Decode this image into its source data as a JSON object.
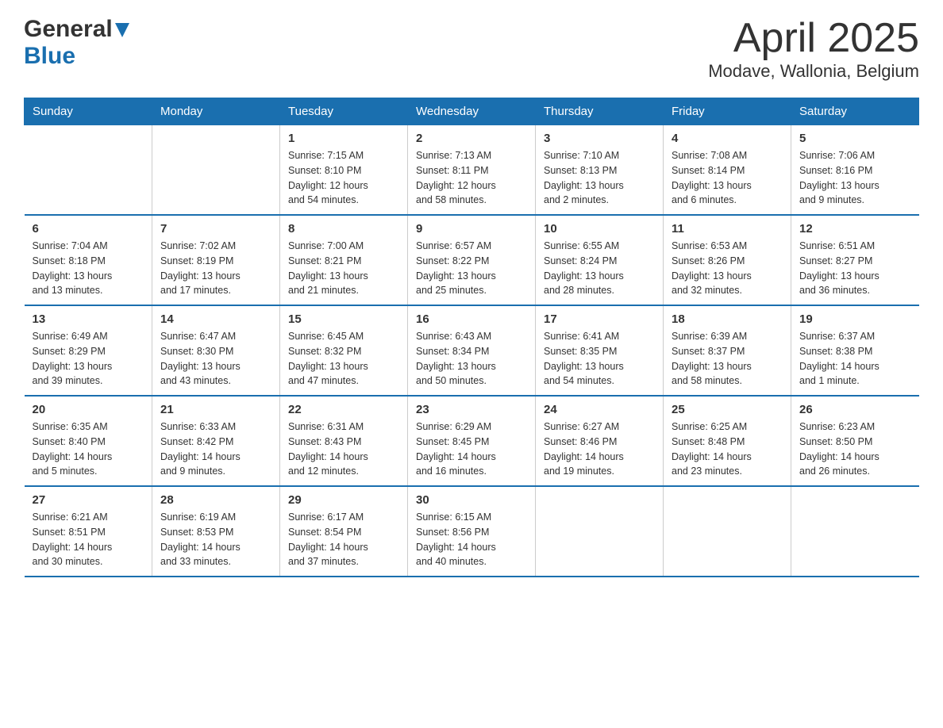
{
  "logo": {
    "general": "General",
    "blue": "Blue",
    "triangle": "▼"
  },
  "title": "April 2025",
  "subtitle": "Modave, Wallonia, Belgium",
  "days_header": [
    "Sunday",
    "Monday",
    "Tuesday",
    "Wednesday",
    "Thursday",
    "Friday",
    "Saturday"
  ],
  "weeks": [
    [
      {
        "day": "",
        "info": ""
      },
      {
        "day": "",
        "info": ""
      },
      {
        "day": "1",
        "info": "Sunrise: 7:15 AM\nSunset: 8:10 PM\nDaylight: 12 hours\nand 54 minutes."
      },
      {
        "day": "2",
        "info": "Sunrise: 7:13 AM\nSunset: 8:11 PM\nDaylight: 12 hours\nand 58 minutes."
      },
      {
        "day": "3",
        "info": "Sunrise: 7:10 AM\nSunset: 8:13 PM\nDaylight: 13 hours\nand 2 minutes."
      },
      {
        "day": "4",
        "info": "Sunrise: 7:08 AM\nSunset: 8:14 PM\nDaylight: 13 hours\nand 6 minutes."
      },
      {
        "day": "5",
        "info": "Sunrise: 7:06 AM\nSunset: 8:16 PM\nDaylight: 13 hours\nand 9 minutes."
      }
    ],
    [
      {
        "day": "6",
        "info": "Sunrise: 7:04 AM\nSunset: 8:18 PM\nDaylight: 13 hours\nand 13 minutes."
      },
      {
        "day": "7",
        "info": "Sunrise: 7:02 AM\nSunset: 8:19 PM\nDaylight: 13 hours\nand 17 minutes."
      },
      {
        "day": "8",
        "info": "Sunrise: 7:00 AM\nSunset: 8:21 PM\nDaylight: 13 hours\nand 21 minutes."
      },
      {
        "day": "9",
        "info": "Sunrise: 6:57 AM\nSunset: 8:22 PM\nDaylight: 13 hours\nand 25 minutes."
      },
      {
        "day": "10",
        "info": "Sunrise: 6:55 AM\nSunset: 8:24 PM\nDaylight: 13 hours\nand 28 minutes."
      },
      {
        "day": "11",
        "info": "Sunrise: 6:53 AM\nSunset: 8:26 PM\nDaylight: 13 hours\nand 32 minutes."
      },
      {
        "day": "12",
        "info": "Sunrise: 6:51 AM\nSunset: 8:27 PM\nDaylight: 13 hours\nand 36 minutes."
      }
    ],
    [
      {
        "day": "13",
        "info": "Sunrise: 6:49 AM\nSunset: 8:29 PM\nDaylight: 13 hours\nand 39 minutes."
      },
      {
        "day": "14",
        "info": "Sunrise: 6:47 AM\nSunset: 8:30 PM\nDaylight: 13 hours\nand 43 minutes."
      },
      {
        "day": "15",
        "info": "Sunrise: 6:45 AM\nSunset: 8:32 PM\nDaylight: 13 hours\nand 47 minutes."
      },
      {
        "day": "16",
        "info": "Sunrise: 6:43 AM\nSunset: 8:34 PM\nDaylight: 13 hours\nand 50 minutes."
      },
      {
        "day": "17",
        "info": "Sunrise: 6:41 AM\nSunset: 8:35 PM\nDaylight: 13 hours\nand 54 minutes."
      },
      {
        "day": "18",
        "info": "Sunrise: 6:39 AM\nSunset: 8:37 PM\nDaylight: 13 hours\nand 58 minutes."
      },
      {
        "day": "19",
        "info": "Sunrise: 6:37 AM\nSunset: 8:38 PM\nDaylight: 14 hours\nand 1 minute."
      }
    ],
    [
      {
        "day": "20",
        "info": "Sunrise: 6:35 AM\nSunset: 8:40 PM\nDaylight: 14 hours\nand 5 minutes."
      },
      {
        "day": "21",
        "info": "Sunrise: 6:33 AM\nSunset: 8:42 PM\nDaylight: 14 hours\nand 9 minutes."
      },
      {
        "day": "22",
        "info": "Sunrise: 6:31 AM\nSunset: 8:43 PM\nDaylight: 14 hours\nand 12 minutes."
      },
      {
        "day": "23",
        "info": "Sunrise: 6:29 AM\nSunset: 8:45 PM\nDaylight: 14 hours\nand 16 minutes."
      },
      {
        "day": "24",
        "info": "Sunrise: 6:27 AM\nSunset: 8:46 PM\nDaylight: 14 hours\nand 19 minutes."
      },
      {
        "day": "25",
        "info": "Sunrise: 6:25 AM\nSunset: 8:48 PM\nDaylight: 14 hours\nand 23 minutes."
      },
      {
        "day": "26",
        "info": "Sunrise: 6:23 AM\nSunset: 8:50 PM\nDaylight: 14 hours\nand 26 minutes."
      }
    ],
    [
      {
        "day": "27",
        "info": "Sunrise: 6:21 AM\nSunset: 8:51 PM\nDaylight: 14 hours\nand 30 minutes."
      },
      {
        "day": "28",
        "info": "Sunrise: 6:19 AM\nSunset: 8:53 PM\nDaylight: 14 hours\nand 33 minutes."
      },
      {
        "day": "29",
        "info": "Sunrise: 6:17 AM\nSunset: 8:54 PM\nDaylight: 14 hours\nand 37 minutes."
      },
      {
        "day": "30",
        "info": "Sunrise: 6:15 AM\nSunset: 8:56 PM\nDaylight: 14 hours\nand 40 minutes."
      },
      {
        "day": "",
        "info": ""
      },
      {
        "day": "",
        "info": ""
      },
      {
        "day": "",
        "info": ""
      }
    ]
  ]
}
